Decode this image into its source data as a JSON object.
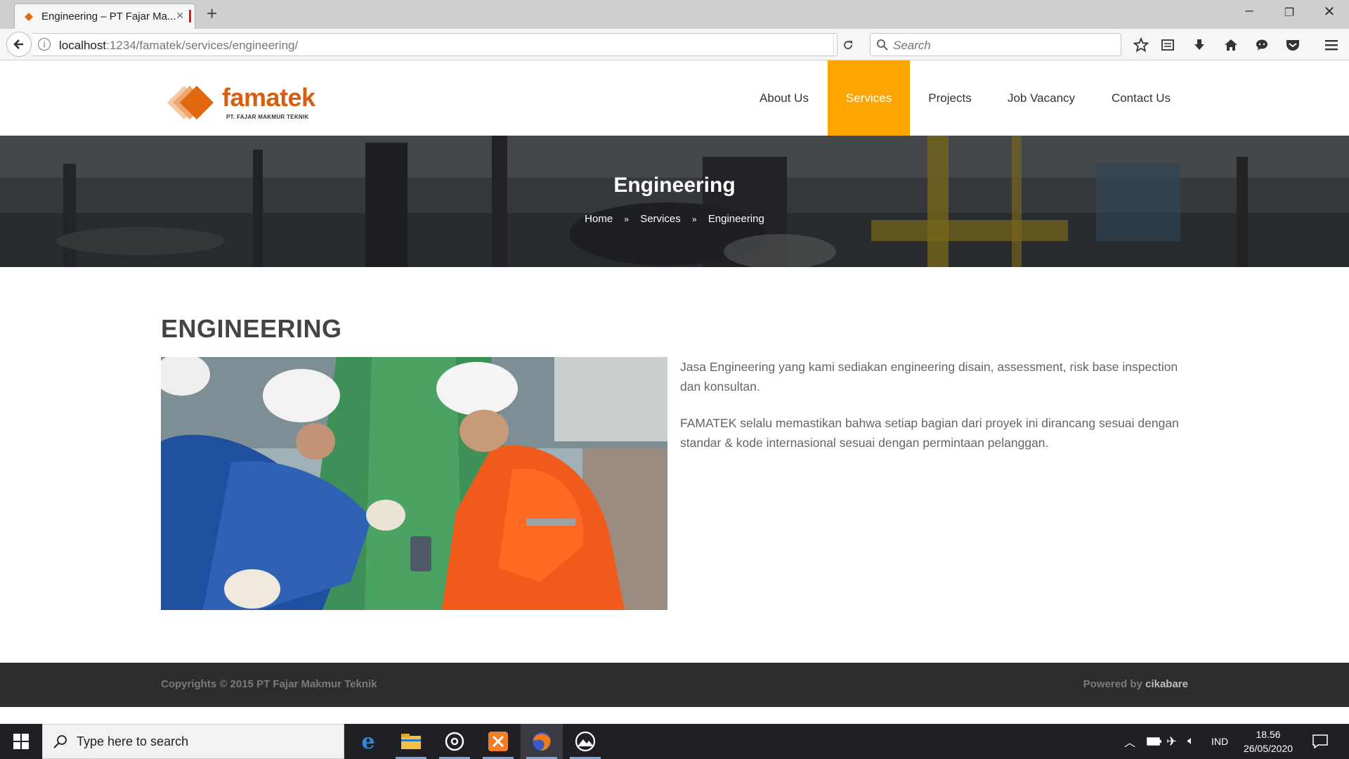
{
  "browser": {
    "tab_title": "Engineering – PT Fajar Ma...",
    "url_host": "localhost",
    "url_path": ":1234/famatek/services/engineering/",
    "search_placeholder": "Search"
  },
  "site": {
    "logo_word": "famatek",
    "logo_sub": "PT. FAJAR MAKMUR TEKNIK",
    "menu": [
      {
        "label": "About Us"
      },
      {
        "label": "Services"
      },
      {
        "label": "Projects"
      },
      {
        "label": "Job Vacancy"
      },
      {
        "label": "Contact Us"
      }
    ],
    "active_menu_color": "#ffa500"
  },
  "hero": {
    "title": "Engineering",
    "breadcrumb": [
      "Home",
      "Services",
      "Engineering"
    ],
    "separator": "»"
  },
  "content": {
    "heading": "ENGINEERING",
    "paragraphs": [
      "Jasa Engineering yang kami sediakan engineering disain, assessment, risk base inspection dan konsultan.",
      "FAMATEK selalu memastikan bahwa setiap bagian dari proyek ini dirancang sesuai dengan standar & kode internasional sesuai dengan permintaan pelanggan."
    ]
  },
  "footer": {
    "copyright": "Copyrights © 2015 PT Fajar Makmur Teknik",
    "powered_prefix": "Powered by",
    "powered_brand": "cikabare"
  },
  "taskbar": {
    "search_placeholder": "Type here to search",
    "language": "IND",
    "time": "18.56",
    "date": "26/05/2020"
  }
}
